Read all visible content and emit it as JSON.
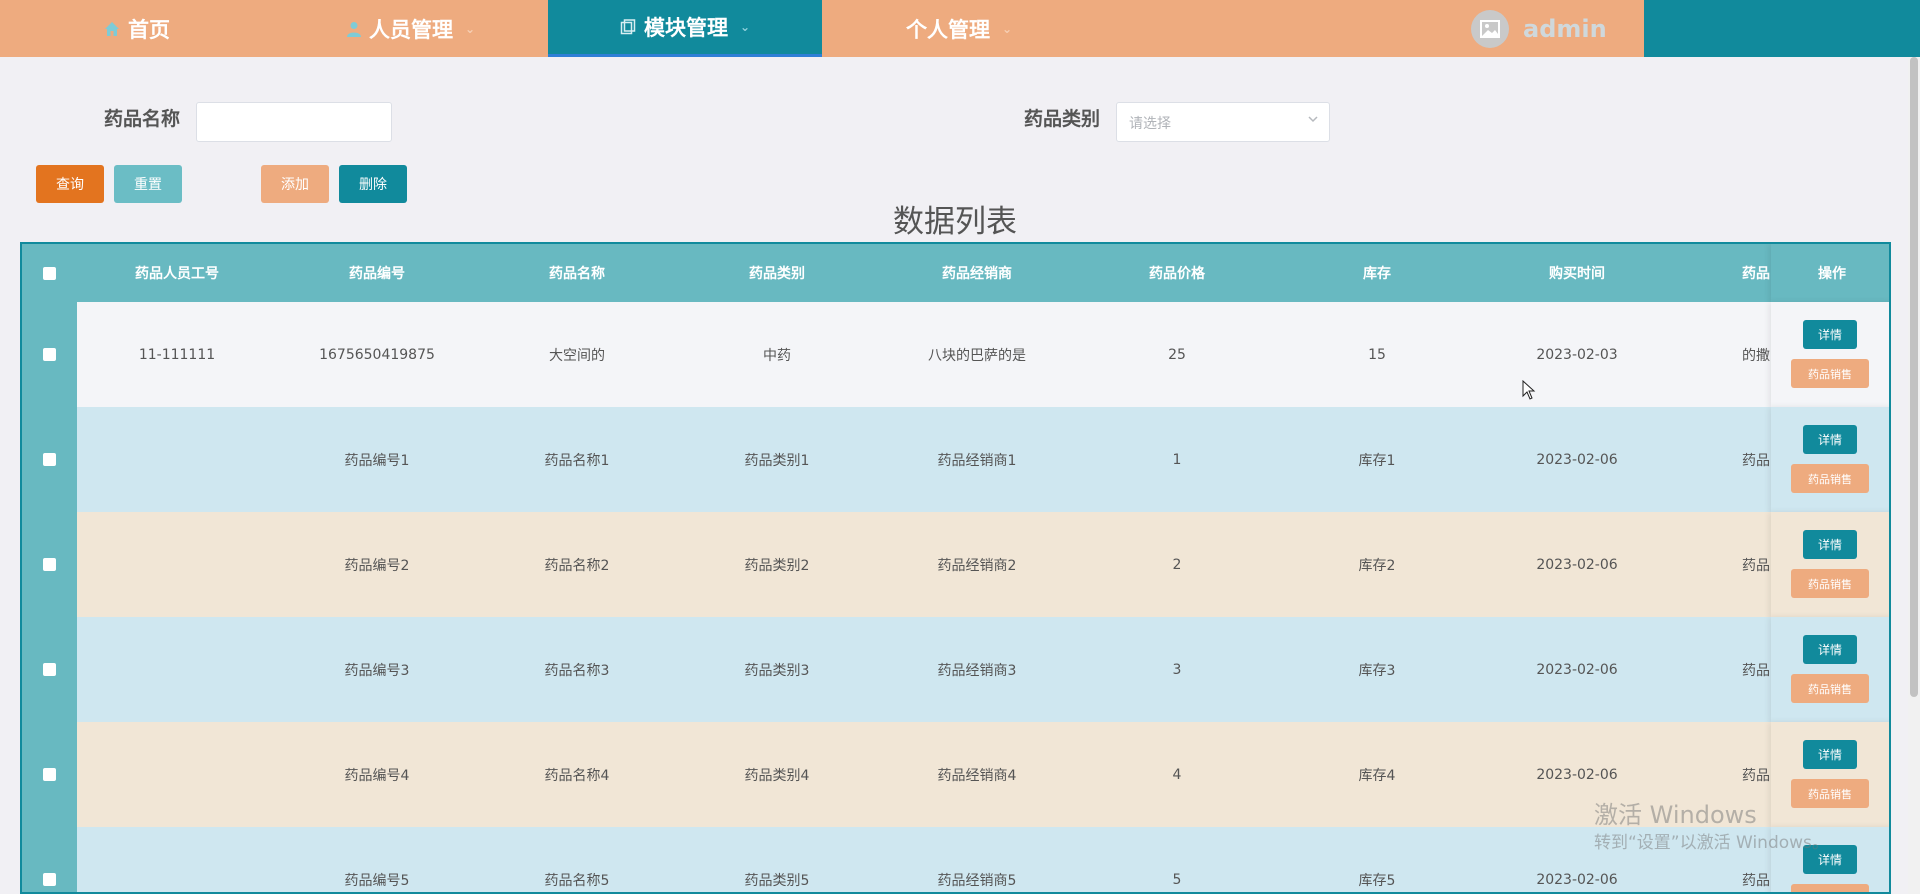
{
  "nav": {
    "items": [
      {
        "label": "首页",
        "icon": "home-icon",
        "dropdown": false
      },
      {
        "label": "人员管理",
        "icon": "user-icon",
        "dropdown": true
      },
      {
        "label": "模块管理",
        "icon": "module-icon",
        "dropdown": true,
        "active": true
      },
      {
        "label": "个人管理",
        "icon": "",
        "dropdown": true
      }
    ],
    "user": "admin"
  },
  "search": {
    "name_label": "药品名称",
    "name_value": "",
    "category_label": "药品类别",
    "category_placeholder": "请选择"
  },
  "actions": {
    "query": "查询",
    "reset": "重置",
    "add": "添加",
    "delete": "删除"
  },
  "list_title": "数据列表",
  "table": {
    "columns": [
      "药品人员工号",
      "药品编号",
      "药品名称",
      "药品类别",
      "药品经销商",
      "药品价格",
      "库存",
      "购买时间",
      "药品"
    ],
    "op_column": "操作",
    "detail_label": "详情",
    "sale_label": "药品销售",
    "rows": [
      [
        "11-111111",
        "1675650419875",
        "大空间的",
        "中药",
        "八块的巴萨的是",
        "25",
        "15",
        "2023-02-03",
        "的撒"
      ],
      [
        "",
        "药品编号1",
        "药品名称1",
        "药品类别1",
        "药品经销商1",
        "1",
        "库存1",
        "2023-02-06",
        "药品"
      ],
      [
        "",
        "药品编号2",
        "药品名称2",
        "药品类别2",
        "药品经销商2",
        "2",
        "库存2",
        "2023-02-06",
        "药品"
      ],
      [
        "",
        "药品编号3",
        "药品名称3",
        "药品类别3",
        "药品经销商3",
        "3",
        "库存3",
        "2023-02-06",
        "药品"
      ],
      [
        "",
        "药品编号4",
        "药品名称4",
        "药品类别4",
        "药品经销商4",
        "4",
        "库存4",
        "2023-02-06",
        "药品"
      ],
      [
        "",
        "药品编号5",
        "药品名称5",
        "药品类别5",
        "药品经销商5",
        "5",
        "库存5",
        "2023-02-06",
        "药品"
      ]
    ]
  },
  "watermark": {
    "line1": "激活 Windows",
    "line2": "转到“设置”以激活 Windows。"
  },
  "colors": {
    "teal": "#118a9c",
    "orange": "#eeab7f",
    "query_orange": "#e3741f",
    "header_teal": "#68b9c1"
  }
}
